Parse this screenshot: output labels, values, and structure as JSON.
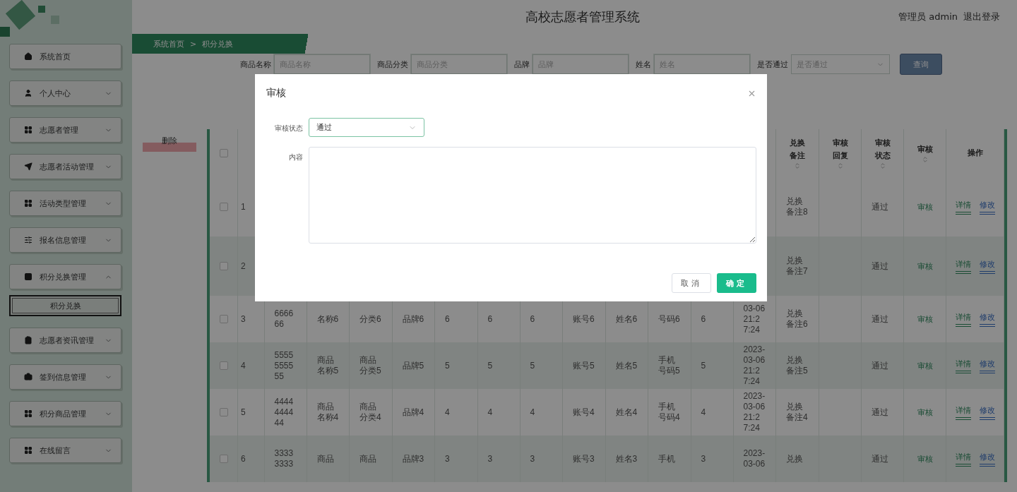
{
  "header": {
    "title": "高校志愿者管理系统",
    "user": "管理员 admin",
    "logout": "退出登录"
  },
  "breadcrumb": [
    "系统首页",
    ">",
    "积分兑换"
  ],
  "sidebar": {
    "items": [
      {
        "kind": "link",
        "label": "系统首页"
      },
      {
        "kind": "menu",
        "label": "个人中心",
        "expanded": false
      },
      {
        "kind": "menu",
        "label": "志愿者管理",
        "expanded": false
      },
      {
        "kind": "menu",
        "label": "志愿者活动管理",
        "expanded": false
      },
      {
        "kind": "menu",
        "label": "活动类型管理",
        "expanded": false
      },
      {
        "kind": "menu",
        "label": "报名信息管理",
        "expanded": false
      },
      {
        "kind": "menu",
        "label": "积分兑换管理",
        "expanded": true,
        "children": [
          {
            "label": "积分兑换",
            "selected": true
          }
        ]
      },
      {
        "kind": "menu",
        "label": "志愿者资讯管理",
        "expanded": false
      },
      {
        "kind": "menu",
        "label": "签到信息管理",
        "expanded": false
      },
      {
        "kind": "menu",
        "label": "积分商品管理",
        "expanded": false
      },
      {
        "kind": "menu",
        "label": "在线留言",
        "expanded": false
      }
    ]
  },
  "filters": [
    {
      "kind": "input",
      "label": "商品名称",
      "placeholder": "商品名称"
    },
    {
      "kind": "input",
      "label": "商品分类",
      "placeholder": "商品分类"
    },
    {
      "kind": "input",
      "label": "品牌",
      "placeholder": "品牌"
    },
    {
      "kind": "input",
      "label": "姓名",
      "placeholder": "姓名"
    },
    {
      "kind": "select",
      "label": "是否通过",
      "placeholder": "是否通过"
    }
  ],
  "search_button": "查询",
  "delete_button": "删除",
  "table": {
    "all_checked": false,
    "columns": [
      null,
      null,
      null,
      null,
      null,
      null,
      null,
      null,
      null,
      null,
      null,
      null,
      null,
      "兑换备注",
      "审核回复",
      "审核状态",
      "审核",
      "操作"
    ],
    "rows": [
      {
        "checked": false,
        "cells": [
          "1",
          null,
          null,
          null,
          null,
          null,
          null,
          null,
          null,
          null,
          null,
          null,
          null,
          "兑换备注8",
          null,
          "通过"
        ],
        "review": "审核",
        "actions": [
          "详情",
          "修改"
        ]
      },
      {
        "checked": false,
        "cells": [
          "2",
          null,
          null,
          null,
          null,
          null,
          null,
          null,
          null,
          null,
          null,
          null,
          null,
          "兑换备注7",
          null,
          "通过"
        ],
        "review": "审核",
        "actions": [
          "详情",
          "修改"
        ]
      },
      {
        "checked": false,
        "cells": [
          "3",
          "666666",
          "名称6",
          "分类6",
          "品牌6",
          "6",
          "6",
          "6",
          "账号6",
          "姓名6",
          "号码6",
          "6",
          "03-06 21:27:24",
          "兑换备注6",
          null,
          "通过"
        ],
        "review": "审核",
        "actions": [
          "详情",
          "修改"
        ]
      },
      {
        "checked": false,
        "cells": [
          "4",
          "5555555555",
          "商品名称5",
          "商品分类5",
          "品牌5",
          "5",
          "5",
          "5",
          "账号5",
          "姓名5",
          "手机号码5",
          "5",
          "2023-03-06 21:27:24",
          "兑换备注5",
          null,
          "通过"
        ],
        "review": "审核",
        "actions": [
          "详情",
          "修改"
        ]
      },
      {
        "checked": false,
        "cells": [
          "5",
          "4444444444",
          "商品名称4",
          "商品分类4",
          "品牌4",
          "4",
          "4",
          "4",
          "账号4",
          "姓名4",
          "手机号码4",
          "4",
          "2023-03-06 21:27:24",
          "兑换备注4",
          null,
          "通过"
        ],
        "review": "审核",
        "actions": [
          "详情",
          "修改"
        ]
      },
      {
        "checked": false,
        "cells": [
          "6",
          "33333333",
          "商品",
          "商品",
          "品牌3",
          "3",
          "3",
          "3",
          "账号3",
          "姓名3",
          "手机",
          "3",
          "2023-03-06",
          "兑换",
          "",
          "通过"
        ],
        "review": "审核",
        "actions": [
          "详情",
          "修改"
        ]
      }
    ]
  },
  "dialog": {
    "title": "审核",
    "fields": [
      {
        "kind": "select",
        "label": "审核状态",
        "value": "通过"
      },
      {
        "kind": "textarea",
        "label": "内容"
      }
    ],
    "cancel": "取消",
    "confirm": "确定"
  }
}
